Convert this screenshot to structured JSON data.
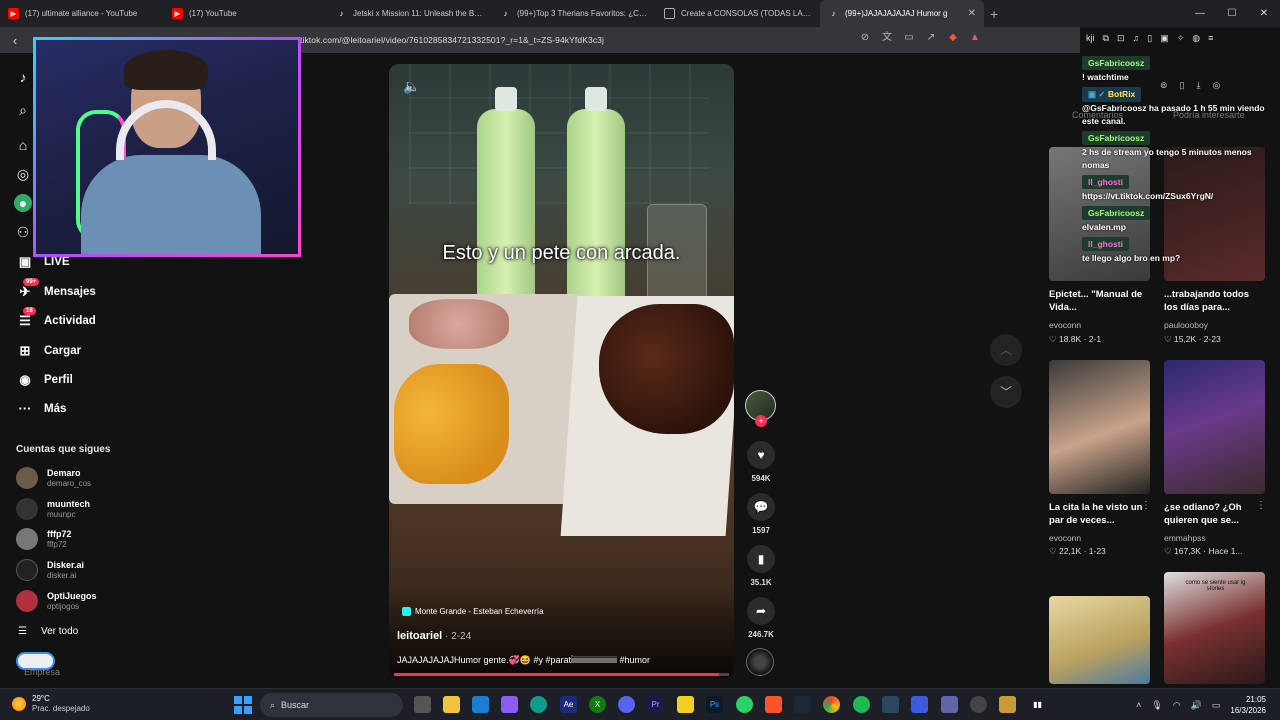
{
  "browser": {
    "tabs": [
      {
        "label": "(17) ultimate alliance - YouTube",
        "favicon": "youtube-icon",
        "color": "#ff0000"
      },
      {
        "label": "(17) YouTube",
        "favicon": "youtube-icon",
        "color": "#ff0000"
      },
      {
        "label": "Jetski x Mission 11: Unleash the Best",
        "favicon": "tiktok-icon",
        "color": "#111111"
      },
      {
        "label": "(99+)Top 3 Therians Favoritos: ¿Cuál",
        "favicon": "tiktok-icon",
        "color": "#111111"
      },
      {
        "label": "Create a CONSOLAS (TODAS LAS GE",
        "favicon": "page-icon",
        "color": "#5f6368"
      },
      {
        "label": "(99+)JAJAJAJAJAJ Humor g",
        "favicon": "tiktok-icon",
        "color": "#111111",
        "active": true
      }
    ],
    "url": "tiktok.com/@leitoariel/video/7610285834721332501?_r=1&_t=ZS-94kYfdK3c3j"
  },
  "sidebar": {
    "nav": [
      {
        "label": "LIVE",
        "icon": "live-icon"
      },
      {
        "label": "Mensajes",
        "icon": "message-icon",
        "badge": "99+"
      },
      {
        "label": "Actividad",
        "icon": "activity-icon",
        "badge": "18"
      },
      {
        "label": "Cargar",
        "icon": "upload-icon"
      },
      {
        "label": "Perfil",
        "icon": "profile-icon"
      },
      {
        "label": "Más",
        "icon": "more-icon"
      }
    ],
    "following_title": "Cuentas que sigues",
    "following": [
      {
        "name": "Demaro",
        "handle": "demaro_cos"
      },
      {
        "name": "muuntech",
        "handle": "muunpc"
      },
      {
        "name": "fffp72",
        "handle": "fffp72"
      },
      {
        "name": "Disker.ai",
        "handle": "disker.ai"
      },
      {
        "name": "OptiJuegos",
        "handle": "optijogos"
      }
    ],
    "see_all": "Ver todo",
    "company": "Empresa"
  },
  "video": {
    "caption": "Esto y un pete con arcada.",
    "location": "Monte Grande - Esteban Echeverría",
    "author": "leitoariel",
    "date": "2-24",
    "description": "JAJAJAJAJAJHumor gente.💞😆 #y #parati̇iiiiiiiiiiiiiiiiiiiiii #humor",
    "progress": 0.97
  },
  "actions": {
    "likes": "594K",
    "comments": "1597",
    "saves": "35.1K",
    "shares": "246.7K"
  },
  "chat": [
    {
      "user": "GsFabricoosz",
      "msg": "! watchtime"
    },
    {
      "user": "BotRix",
      "msg": "@GsFabricoosz ha pasado 1 h 55 min viendo este canal.",
      "bot": true
    },
    {
      "user": "GsFabricoosz",
      "msg": "2 hs de stream yo tengo 5 minutos menos nomas"
    },
    {
      "user": "ll_ghosti",
      "msg": "https://vt.tiktok.com/ZSux6YrgN/"
    },
    {
      "user": "GsFabricoosz",
      "msg": "elvalen.mp"
    },
    {
      "user": "ll_ghosti",
      "msg": "te llego algo bro en mp?"
    }
  ],
  "right_tabs": {
    "comments": "Comentarios",
    "interest": "Podría interesarte"
  },
  "recommended": [
    {
      "title": "Epictet... \"Manual de Vida...",
      "author": "evoconn",
      "likes": "18.8K",
      "date": "2-1"
    },
    {
      "title": "...trabajando todos los días para...",
      "author": "pauloooboy",
      "likes": "15,2K",
      "date": "2-23"
    },
    {
      "title": "La cita la he visto un par de veces...",
      "author": "evoconn",
      "likes": "22,1K",
      "date": "1-23"
    },
    {
      "title": "¿se odiano? ¿Oh quieren que se...",
      "author": "emmahpss",
      "likes": "167,3K",
      "date": "Hace 1..."
    },
    {
      "title": "",
      "author": "",
      "likes": "",
      "date": ""
    },
    {
      "title": "",
      "author": "",
      "likes": "",
      "date": "",
      "overlay": "como se siente usar ig stories"
    }
  ],
  "taskbar": {
    "weather_temp": "29°C",
    "weather_desc": "Prac. despejado",
    "search": "Buscar",
    "time": "21:05",
    "date": "16/3/2026"
  }
}
